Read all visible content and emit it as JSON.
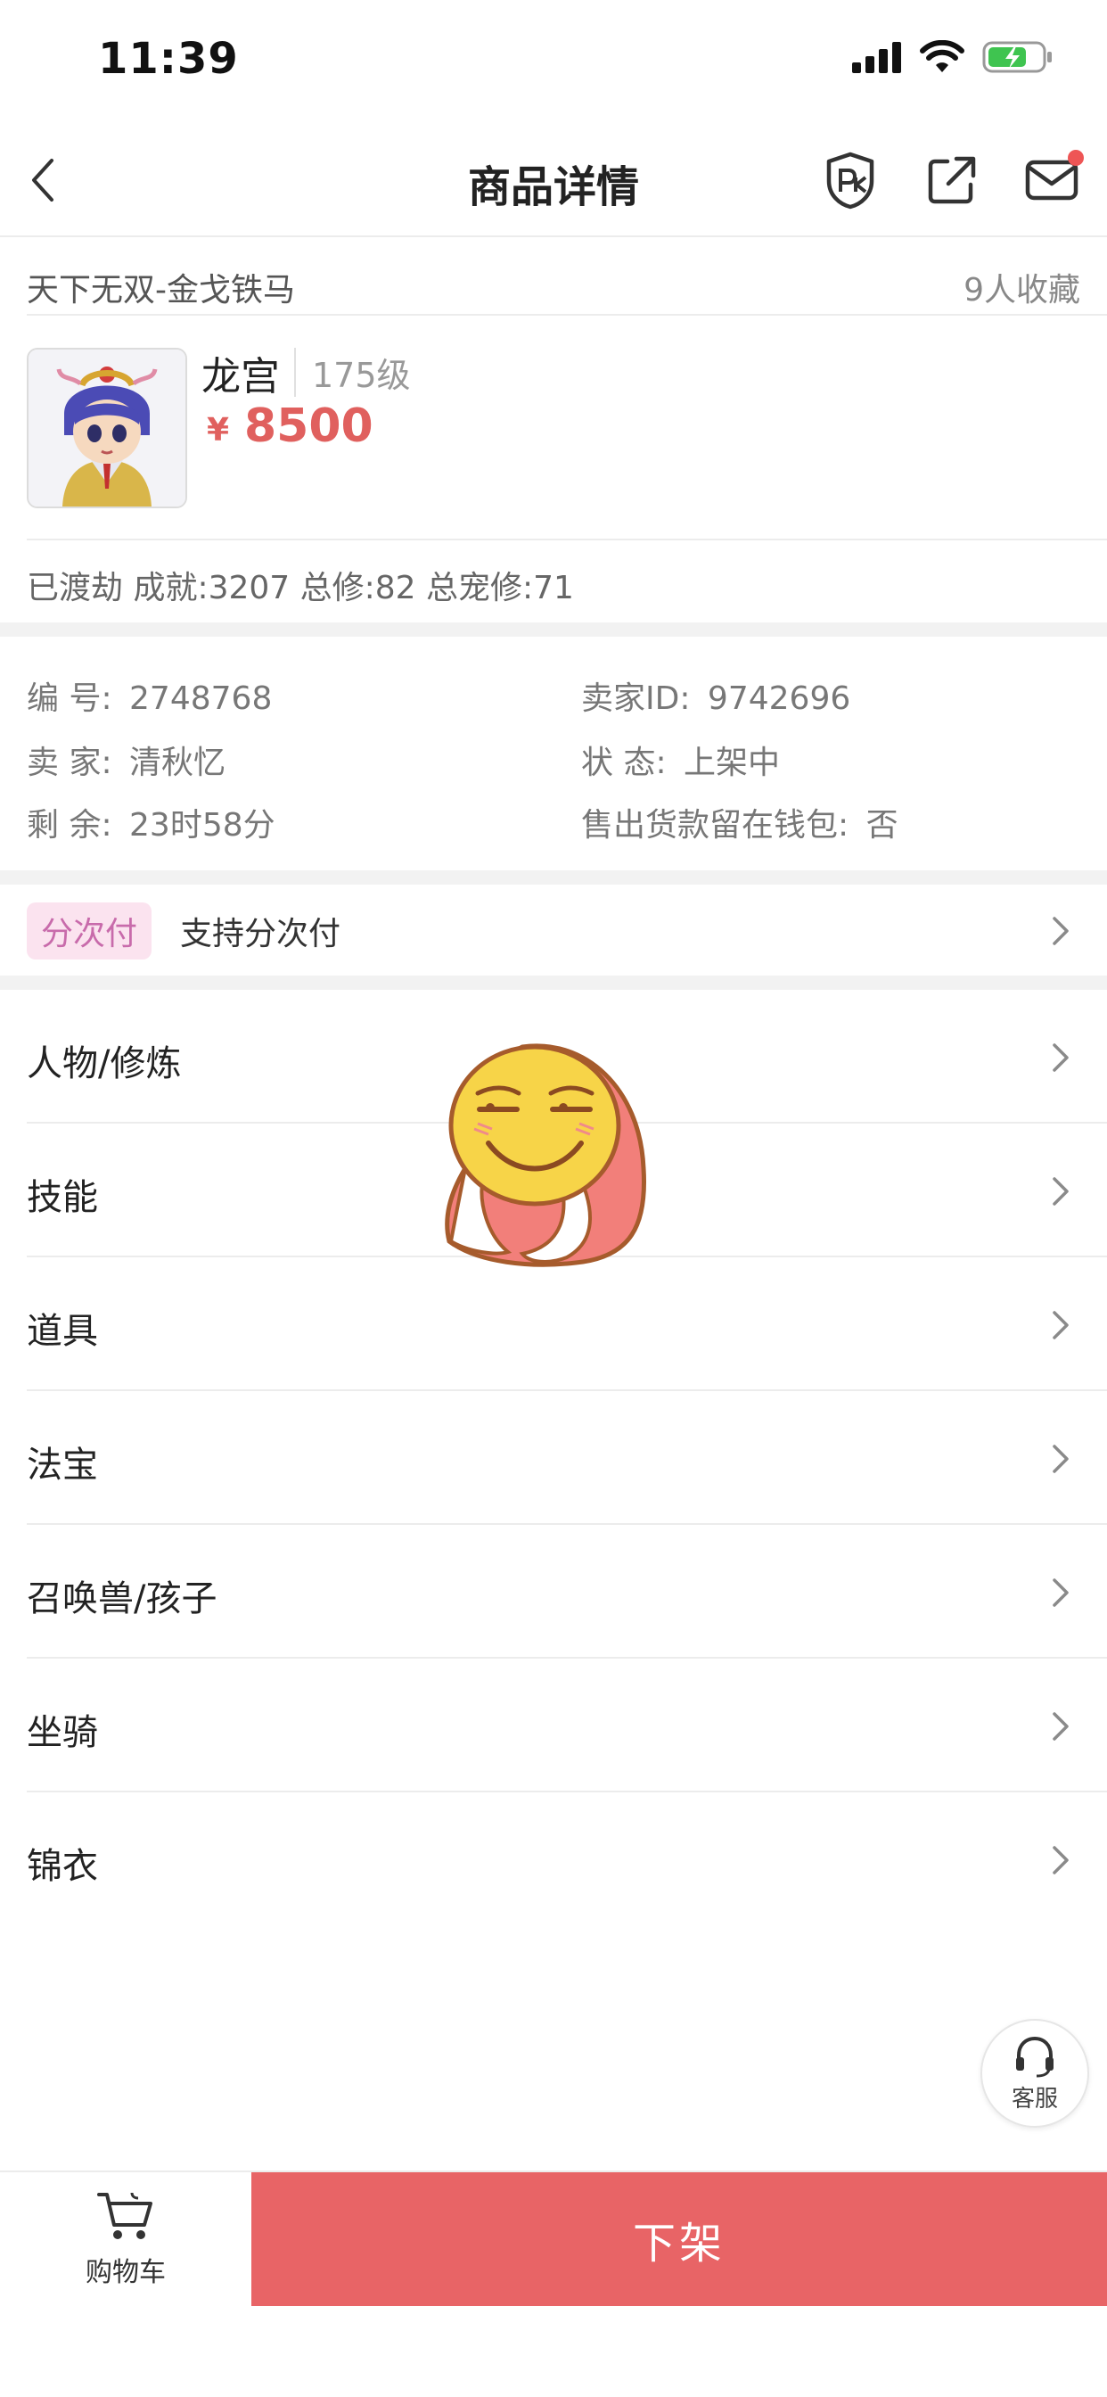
{
  "status_bar": {
    "time": "11:39"
  },
  "nav": {
    "title": "商品详情"
  },
  "listing": {
    "server": "天下无双-金戈铁马",
    "favorites": "9人收藏",
    "role_name": "龙宫",
    "level": "175级",
    "currency": "¥",
    "price": "8500",
    "stats": "已渡劫 成就:3207 总修:82 总宠修:71"
  },
  "info": {
    "serial_label": "编 号:",
    "serial": "2748768",
    "seller_id_label": "卖家ID:",
    "seller_id": "9742696",
    "seller_label": "卖 家:",
    "seller": "清秋忆",
    "status_label": "状 态:",
    "status": "上架中",
    "remaining_label": "剩 余:",
    "remaining": "23时58分",
    "wallet_label": "售出货款留在钱包:",
    "wallet": "否"
  },
  "installment": {
    "badge": "分次付",
    "text": "支持分次付"
  },
  "sections": [
    {
      "label": "人物/修炼"
    },
    {
      "label": "技能"
    },
    {
      "label": "道具"
    },
    {
      "label": "法宝"
    },
    {
      "label": "召唤兽/孩子"
    },
    {
      "label": "坐骑"
    },
    {
      "label": "锦衣"
    }
  ],
  "customer_service": {
    "label": "客服"
  },
  "bottom": {
    "cart_label": "购物车",
    "action_label": "下架"
  },
  "colors": {
    "price": "#e0605e",
    "action": "#e86466",
    "badge_bg": "#fbe3ef",
    "badge_text": "#c86bab"
  }
}
